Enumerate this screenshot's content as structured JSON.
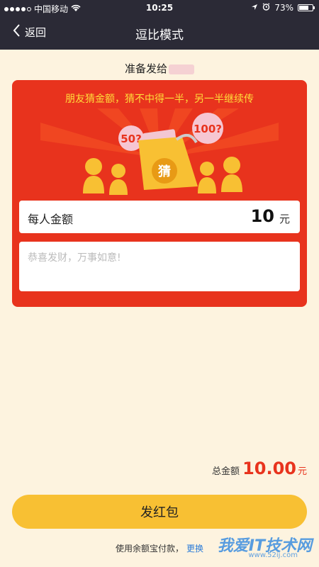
{
  "statusbar": {
    "carrier": "中国移动",
    "time": "10:25",
    "battery_text": "73%",
    "battery_level": 0.73
  },
  "nav": {
    "back_label": "返回",
    "title": "逗比模式"
  },
  "recipient": {
    "prefix": "准备发给"
  },
  "card": {
    "tip": "朋友猜金额，猜不中得一半，另一半继续传",
    "bubble_left": "50?",
    "bubble_right": "100?",
    "bag_char": "猜",
    "amount_label": "每人金额",
    "amount_value": "10",
    "amount_unit": "元",
    "message_placeholder": "恭喜发财，万事如意!"
  },
  "total": {
    "label": "总金额",
    "value": "10.00",
    "unit": "元"
  },
  "send_button": "发红包",
  "payment": {
    "text": "使用余额宝付款，",
    "change": "更换"
  },
  "watermark": {
    "text": "我爱IT技术网",
    "url": "www.52ij.com"
  },
  "colors": {
    "nav_bg": "#2b2a36",
    "page_bg": "#fdf3df",
    "card_red": "#e8331d",
    "tip_yellow": "#ffdd3a",
    "button_yellow": "#f8c033"
  }
}
